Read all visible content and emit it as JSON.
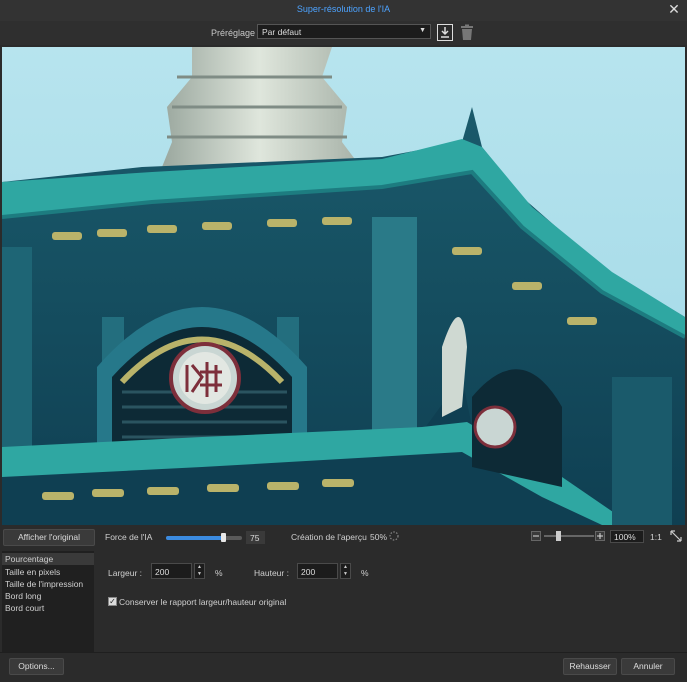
{
  "window": {
    "title": "Super-résolution de l'IA"
  },
  "preset": {
    "label": "Préréglage",
    "value": "Par défaut"
  },
  "controls": {
    "show_original_label": "Afficher l'original",
    "ai_strength_label": "Force de l'IA",
    "ai_strength_value": "75",
    "ai_strength_level": 0.75,
    "preview_creation_label": "Création de l'aperçu",
    "preview_creation_percent": "50%",
    "zoom_value": "100%",
    "zoom_actual_label": "1:1"
  },
  "size_modes": [
    {
      "label": "Pourcentage",
      "active": true
    },
    {
      "label": "Taille en pixels",
      "active": false
    },
    {
      "label": "Taille de l'impression",
      "active": false
    },
    {
      "label": "Bord long",
      "active": false
    },
    {
      "label": "Bord court",
      "active": false
    }
  ],
  "dimensions": {
    "width_label": "Largeur :",
    "width_value": "200",
    "height_label": "Hauteur :",
    "height_value": "200",
    "unit": "%",
    "keep_ratio_label": "Conserver le rapport largeur/hauteur original",
    "keep_ratio_checked": true
  },
  "footer": {
    "options_label": "Options...",
    "enhance_label": "Rehausser",
    "cancel_label": "Annuler"
  },
  "colors": {
    "accent": "#3b8be0",
    "title": "#4da3ff"
  }
}
